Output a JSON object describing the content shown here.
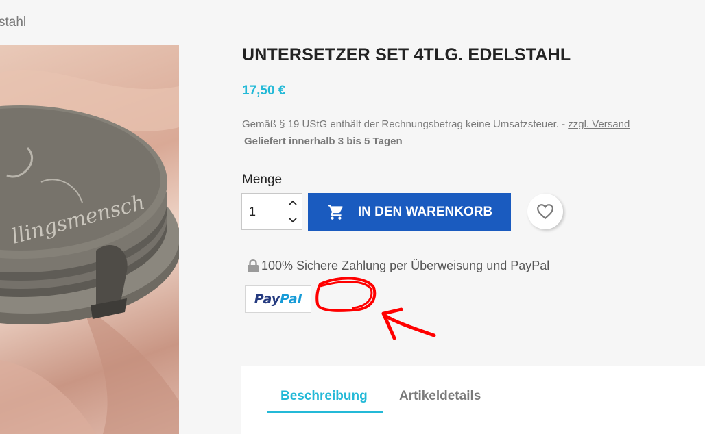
{
  "breadcrumb": {
    "tail": "stahl"
  },
  "product": {
    "title": "UNTERSETZER SET 4TLG. EDELSTAHL",
    "price": "17,50 €",
    "tax_note": "Gemäß § 19 UStG enthält der Rechnungsbetrag keine Umsatzsteuer. - ",
    "shipping_link": "zzgl. Versand",
    "delivery": "Geliefert innerhalb 3 bis 5 Tagen",
    "image_alt": "Untersetzer Set Edelstahl auf rosa Stoff"
  },
  "quantity": {
    "label": "Menge",
    "value": "1"
  },
  "cart": {
    "label": "IN DEN WARENKORB"
  },
  "payment": {
    "secure_text": "100% Sichere Zahlung per Überweisung und PayPal",
    "paypal_dark": "Pay",
    "paypal_light": "Pal"
  },
  "tabs": [
    {
      "label": "Beschreibung",
      "active": true
    },
    {
      "label": "Artikeldetails",
      "active": false
    }
  ],
  "colors": {
    "accent": "#24b9d7",
    "cart_button": "#1a5bbf",
    "annotation": "#ff0000"
  },
  "icons": {
    "cart": "shopping-cart-icon",
    "wishlist": "heart-icon",
    "lock": "lock-icon",
    "qty_up": "chevron-up-icon",
    "qty_down": "chevron-down-icon"
  }
}
